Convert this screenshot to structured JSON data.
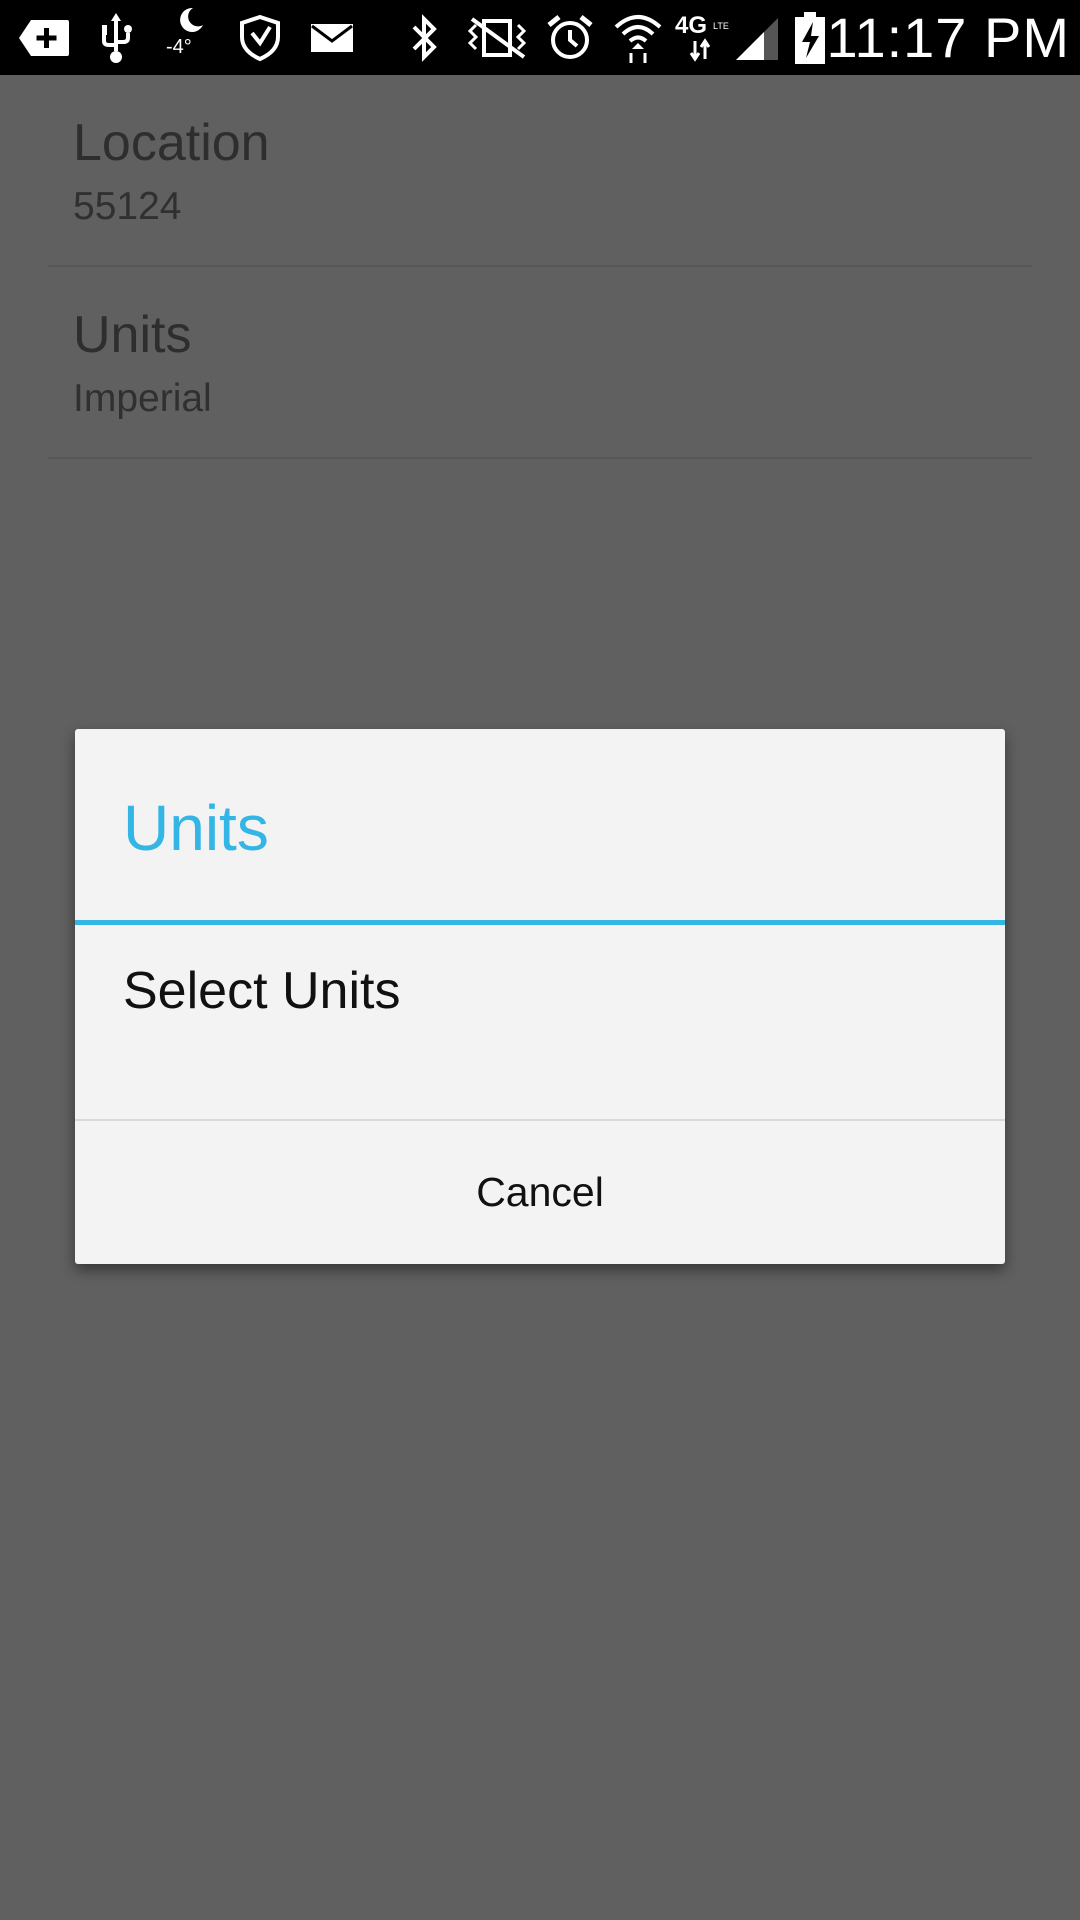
{
  "status_bar": {
    "time": "11:17 PM",
    "temperature": "-4°",
    "icons": [
      "add-notification-icon",
      "usb-icon",
      "weather-moon-icon",
      "security-shield-icon",
      "email-icon",
      "bluetooth-icon",
      "vibrate-mute-icon",
      "alarm-icon",
      "wifi-icon",
      "4g-lte-icon",
      "signal-strength-icon",
      "battery-charging-icon"
    ]
  },
  "preferences": [
    {
      "title": "Location",
      "summary": "55124"
    },
    {
      "title": "Units",
      "summary": "Imperial"
    }
  ],
  "dialog": {
    "title": "Units",
    "message": "Select Units",
    "cancel_label": "Cancel",
    "accent_color": "#33b5e5"
  }
}
